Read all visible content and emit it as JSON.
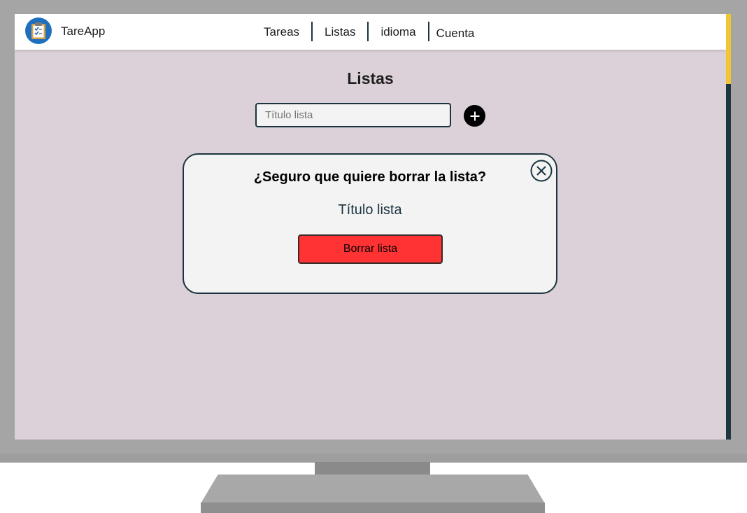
{
  "app": {
    "name": "TareApp",
    "logo_icon": "clipboard-icon",
    "accent": "#1f6fbf"
  },
  "nav": {
    "items": [
      {
        "label": "Tareas"
      },
      {
        "label": "Listas"
      },
      {
        "label": "idioma"
      },
      {
        "label": "Cuenta"
      }
    ]
  },
  "page": {
    "title": "Listas",
    "input_placeholder": "Título lista",
    "add_icon": "plus-circle-icon"
  },
  "dialog": {
    "title": "¿Seguro que quiere borrar la lista?",
    "list_name": "Título lista",
    "delete_label": "Borrar lista",
    "delete_color": "#ff3333",
    "close_icon": "close-circle-icon"
  },
  "colors": {
    "background": "#dcd1d8",
    "dark": "#1b3440",
    "scroll_thumb": "#f2c532"
  }
}
